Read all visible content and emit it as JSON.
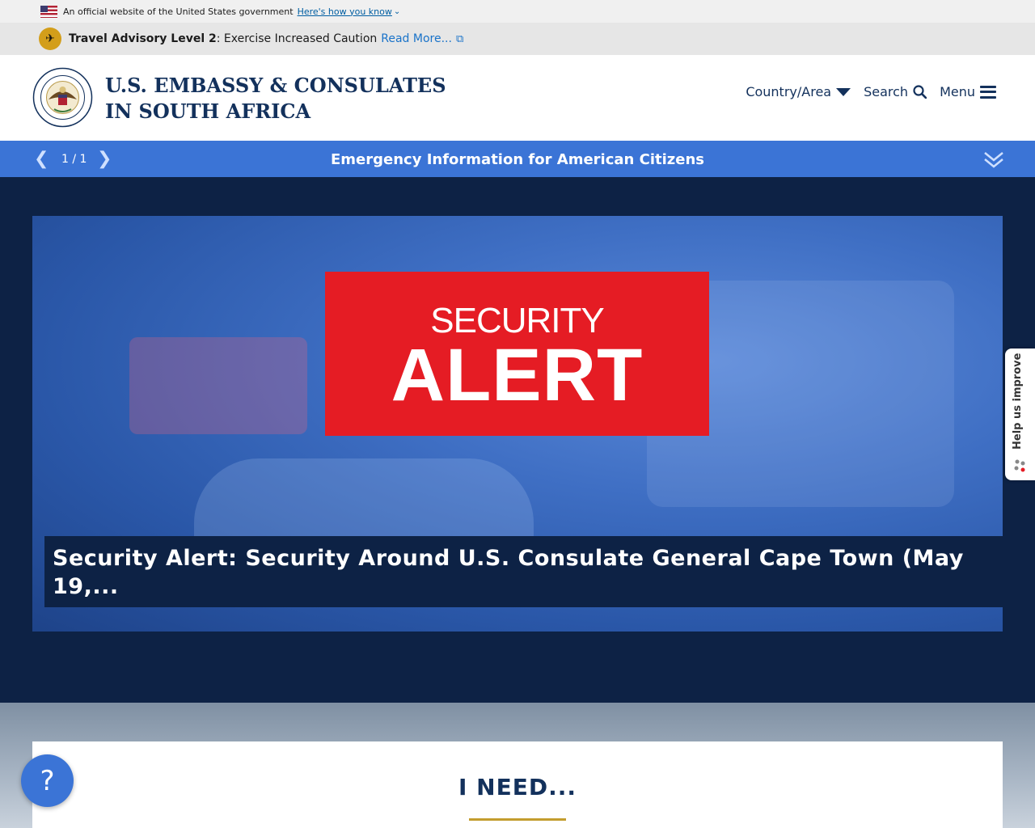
{
  "gov_banner": {
    "text": "An official website of the United States government",
    "link": "Here's how you know",
    "flag_icon": "us-flag-icon",
    "chevron_icon": "chevron-down-icon"
  },
  "advisory": {
    "icon": "plane-pin-icon",
    "level": "Travel Advisory Level 2",
    "text": ": Exercise Increased Caution",
    "link": "Read More...",
    "link_icon": "external-link-icon",
    "pin_color": "#d39e1a"
  },
  "header": {
    "title_line1": "U.S. EMBASSY & CONSULATES",
    "title_line2": "IN SOUTH AFRICA",
    "seal_icon": "embassy-seal-icon",
    "nav": {
      "country": "Country/Area",
      "search": "Search",
      "menu": "Menu"
    }
  },
  "emergency": {
    "count": "1 / 1",
    "title": "Emergency Information for American Citizens",
    "prev_icon": "chevron-left-icon",
    "next_icon": "chevron-right-icon",
    "expand_icon": "double-chevron-down-icon",
    "color": "#3b74d6"
  },
  "hero": {
    "alert_small": "SECURITY",
    "alert_big": "ALERT",
    "caption_line1": "Security Alert: Security Around U.S. Consulate General Cape Town (May",
    "caption_line2": "19,...",
    "alert_color": "#e51c24"
  },
  "i_need": {
    "title": "I NEED..."
  },
  "floating": {
    "help": "?",
    "feedback": "Help us improve"
  },
  "colors": {
    "navy": "#13315c",
    "dark_bg": "#0d2245",
    "gold": "#c39d2e"
  }
}
